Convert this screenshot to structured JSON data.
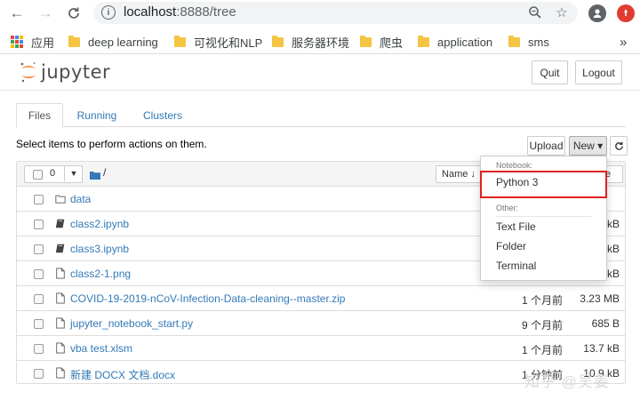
{
  "browser": {
    "url_host": "localhost",
    "url_rest": ":8888/tree",
    "bookmarks": [
      {
        "label": "应用",
        "kind": "apps"
      },
      {
        "label": "deep learning",
        "kind": "folder"
      },
      {
        "label": "可视化和NLP",
        "kind": "folder"
      },
      {
        "label": "服务器环境",
        "kind": "folder"
      },
      {
        "label": "爬虫",
        "kind": "folder"
      },
      {
        "label": "application",
        "kind": "folder"
      },
      {
        "label": "sms",
        "kind": "folder"
      }
    ],
    "more": "»"
  },
  "header": {
    "logo_text": "jupyter",
    "quit_label": "Quit",
    "logout_label": "Logout"
  },
  "tabs": [
    {
      "label": "Files",
      "active": true
    },
    {
      "label": "Running",
      "active": false
    },
    {
      "label": "Clusters",
      "active": false
    }
  ],
  "toolbar": {
    "hint": "Select items to perform actions on them.",
    "upload_label": "Upload",
    "new_label": "New ▾",
    "refresh_icon": "refresh-icon"
  },
  "list_header": {
    "selected_count": "0",
    "path": "/",
    "name_sort_label": "Name ↓",
    "partial_header": "e"
  },
  "files": [
    {
      "name": "data",
      "type": "folder",
      "date": "",
      "size": ""
    },
    {
      "name": "class2.ipynb",
      "type": "notebook",
      "date": "",
      "size": "kB"
    },
    {
      "name": "class3.ipynb",
      "type": "notebook",
      "date": "",
      "size": "kB"
    },
    {
      "name": "class2-1.png",
      "type": "file",
      "date": "",
      "size": "kB"
    },
    {
      "name": "COVID-19-2019-nCoV-Infection-Data-cleaning--master.zip",
      "type": "file",
      "date": "1 个月前",
      "size": "3.23 MB"
    },
    {
      "name": "jupyter_notebook_start.py",
      "type": "file",
      "date": "9 个月前",
      "size": "685 B"
    },
    {
      "name": "vba test.xlsm",
      "type": "file",
      "date": "1 个月前",
      "size": "13.7 kB"
    },
    {
      "name": "新建 DOCX 文档.docx",
      "type": "file",
      "date": "1 分钟前",
      "size": "10.9 kB"
    }
  ],
  "new_menu": {
    "notebook_header": "Notebook:",
    "python3": "Python 3",
    "other_header": "Other:",
    "text_file": "Text File",
    "folder": "Folder",
    "terminal": "Terminal"
  },
  "watermark": "知乎 @吴姜",
  "colors": {
    "link": "#337ab7",
    "highlight": "#e02020",
    "jupyter_orange": "#f37626"
  }
}
